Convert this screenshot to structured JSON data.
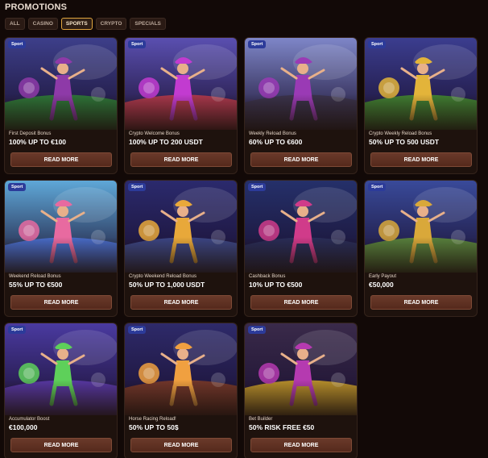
{
  "page_title": "PROMOTIONS",
  "tabs": [
    {
      "label": "ALL",
      "active": false
    },
    {
      "label": "CASINO",
      "active": false
    },
    {
      "label": "SPORTS",
      "active": true
    },
    {
      "label": "CRYPTO",
      "active": false
    },
    {
      "label": "SPECIALS",
      "active": false
    }
  ],
  "badge_label": "Sport",
  "button_label": "READ MORE",
  "colors": {
    "background": "#120907",
    "card": "#1e120d",
    "button": "#5e3020",
    "active_tab_border": "#e0a53e",
    "badge": "#2c3b9a"
  },
  "cards": [
    {
      "name": "First Deposit Bonus",
      "offer": "100% UP TO €100",
      "art": {
        "icon": "soccer-players-icon",
        "sky": "#3d3f8a",
        "ground": "#2f7b35",
        "accent": "#8e3aa8"
      }
    },
    {
      "name": "Crypto Welcome Bonus",
      "offer": "100% UP TO 200 USDT",
      "art": {
        "icon": "race-car-cowgirl-icon",
        "sky": "#5a4fb0",
        "ground": "#b53a4a",
        "accent": "#c23bd0"
      }
    },
    {
      "name": "Weekly Reload Bonus",
      "offer": "60% UP TO €600",
      "art": {
        "icon": "quad-bike-icon",
        "sky": "#7e86c8",
        "ground": "#3a3248",
        "accent": "#9a3ab5"
      }
    },
    {
      "name": "Crypto Weekly Reload Bonus",
      "offer": "50% UP TO 500 USDT",
      "art": {
        "icon": "cricket-bitcoin-icon",
        "sky": "#3b3d8f",
        "ground": "#43862f",
        "accent": "#e3b43a"
      }
    },
    {
      "name": "Weekend Reload Bonus",
      "offer": "55% UP TO €500",
      "art": {
        "icon": "pool-float-icon",
        "sky": "#5fa8d8",
        "ground": "#4a6fd0",
        "accent": "#e86aa0"
      }
    },
    {
      "name": "Crypto Weekend Reload Bonus",
      "offer": "50% UP TO 1,000 USDT",
      "art": {
        "icon": "winged-bitcoin-icon",
        "sky": "#2b2a6d",
        "ground": "#3e4a8a",
        "accent": "#e8a83a"
      }
    },
    {
      "name": "Cashback Bonus",
      "offer": "10% UP TO €500",
      "art": {
        "icon": "percent-wheel-icon",
        "sky": "#25306a",
        "ground": "#2a2f5a",
        "accent": "#d03b8a"
      }
    },
    {
      "name": "Early Payout",
      "offer": "€50,000",
      "art": {
        "icon": "bulls-icon",
        "sky": "#394a9a",
        "ground": "#5d8a3a",
        "accent": "#d9a83a"
      }
    },
    {
      "name": "Accumulator Boost",
      "offer": "€100,000",
      "art": {
        "icon": "money-cowgirl-icon",
        "sky": "#4a3aa0",
        "ground": "#5b3aa8",
        "accent": "#5ed05a"
      }
    },
    {
      "name": "Horse Racing Reload!",
      "offer": "50% UP TO 50$",
      "art": {
        "icon": "horses-icon",
        "sky": "#2e2a6a",
        "ground": "#7a3a28",
        "accent": "#f0a040"
      }
    },
    {
      "name": "Bet Builder",
      "offer": "50% RISK FREE €50",
      "art": {
        "icon": "engine-car-icon",
        "sky": "#3a2a4a",
        "ground": "#c49a2a",
        "accent": "#b53ab0"
      }
    }
  ]
}
